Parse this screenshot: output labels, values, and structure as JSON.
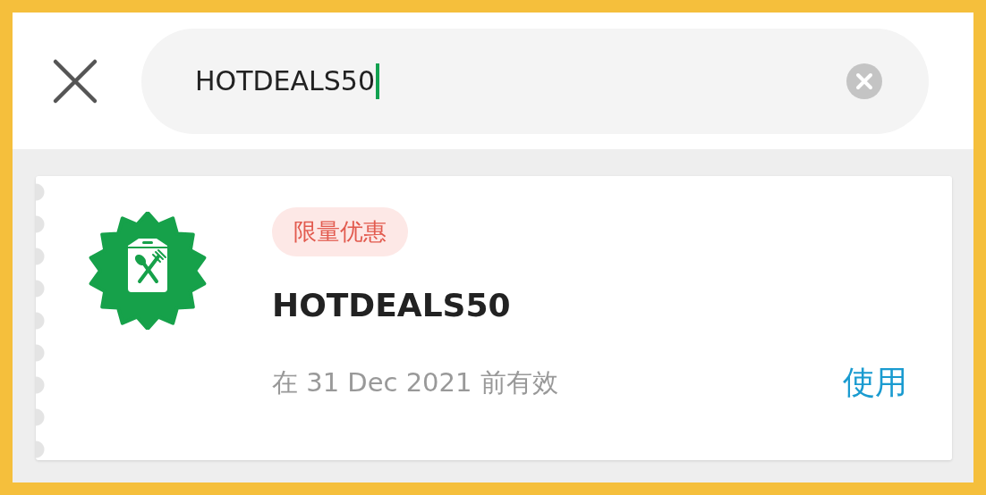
{
  "search": {
    "value": "HOTDEALS50",
    "focused": true
  },
  "vouchers": [
    {
      "tag": "限量优惠",
      "code": "HOTDEALS50",
      "validity": "在 31 Dec 2021 前有效",
      "action": "使用"
    }
  ]
}
